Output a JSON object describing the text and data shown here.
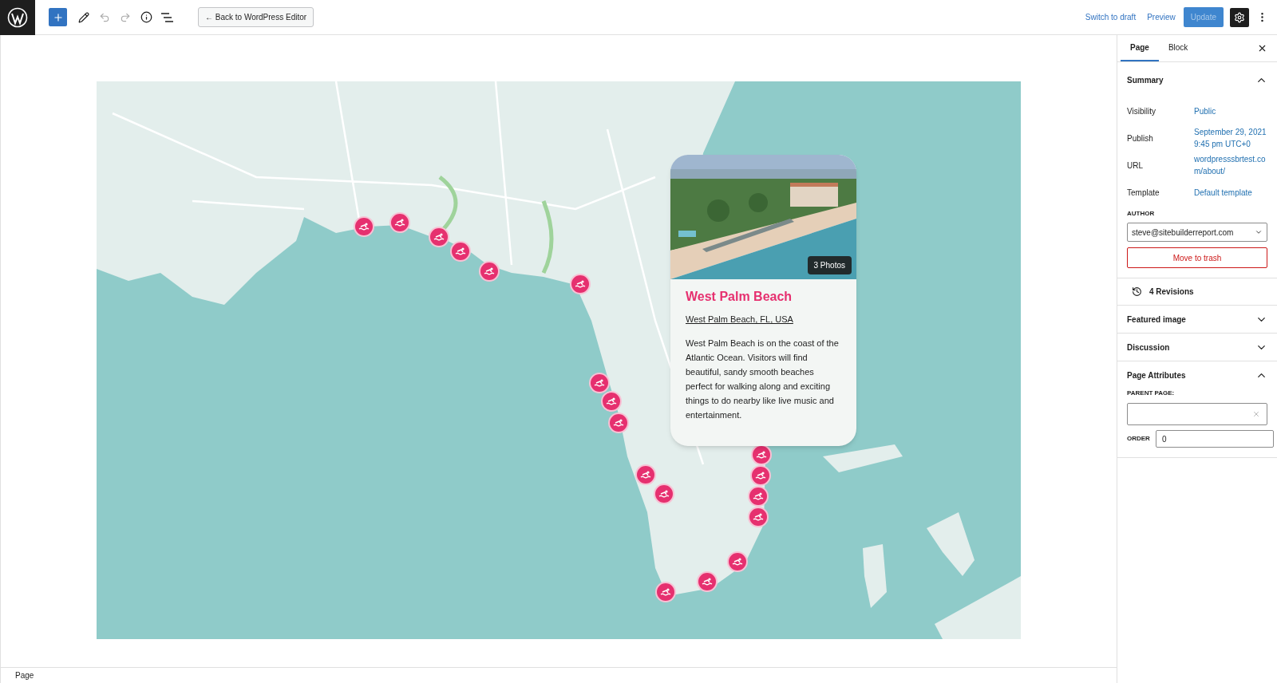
{
  "toolbar": {
    "back_button": "← Back to WordPress Editor",
    "switch_to_draft": "Switch to draft",
    "preview": "Preview",
    "update": "Update",
    "update_disabled": true
  },
  "map": {
    "card": {
      "photos": "3 Photos",
      "title": "West Palm Beach",
      "address": "West Palm Beach, FL, USA",
      "description": "West Palm Beach is on the coast of the Atlantic Ocean. Visitors will find beautiful, sandy smooth beaches perfect for walking along and exciting things to do nearby like live music and entertainment."
    }
  },
  "sidebar": {
    "tabs": [
      {
        "label": "Page",
        "selected": true
      },
      {
        "label": "Block",
        "selected": false
      }
    ],
    "sections": [
      {
        "kind": "summary",
        "title": "Summary",
        "expanded": true,
        "rows": [
          {
            "label": "Visibility",
            "value": "Public"
          },
          {
            "label": "Publish",
            "value": "September 29, 2021 9:45 pm UTC+0"
          },
          {
            "label": "URL",
            "value": "wordpresssbrtest.com/about/"
          },
          {
            "label": "Template",
            "value": "Default template"
          }
        ],
        "author_label": "AUTHOR",
        "author": "steve@sitebuilderreport.com",
        "trash": "Move to trash"
      },
      {
        "kind": "revisions",
        "title": "4 Revisions"
      },
      {
        "kind": "panel",
        "title": "Featured image",
        "expanded": false
      },
      {
        "kind": "panel",
        "title": "Discussion",
        "expanded": false
      },
      {
        "kind": "attributes",
        "title": "Page Attributes",
        "expanded": true,
        "parent_label": "PARENT PAGE:",
        "order_label": "ORDER",
        "order": "0"
      }
    ]
  },
  "footer": {
    "breadcrumb": "Page"
  }
}
